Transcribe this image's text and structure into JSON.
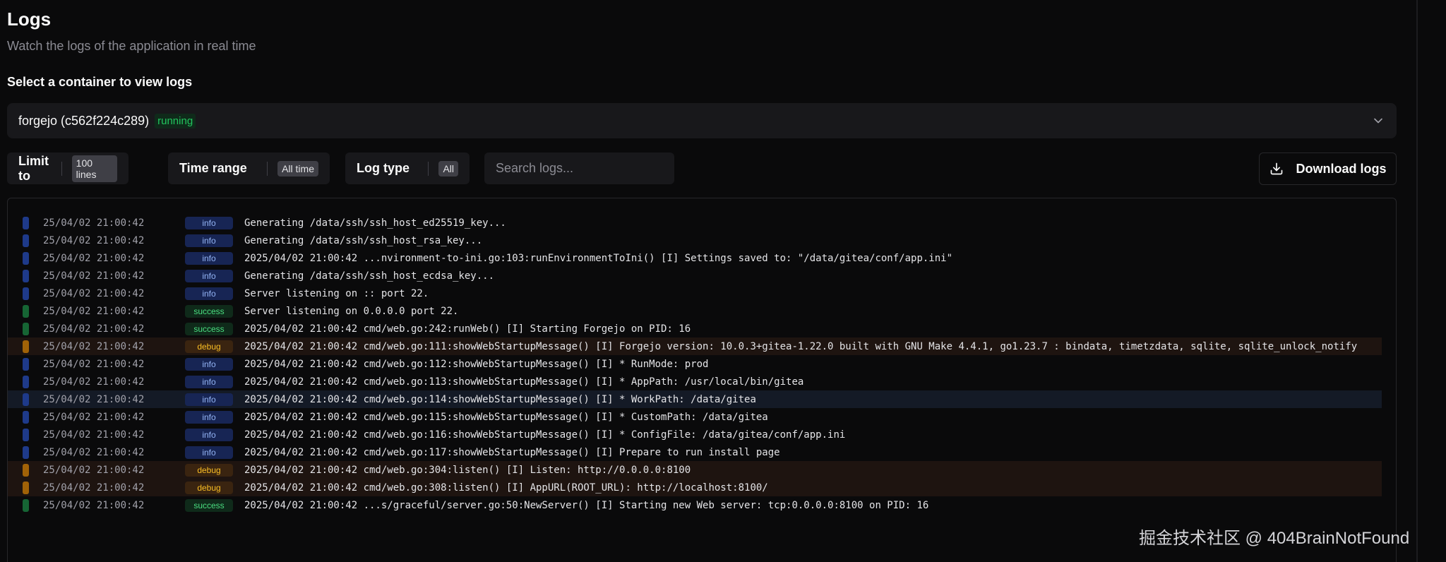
{
  "header": {
    "title": "Logs",
    "subtitle": "Watch the logs of the application in real time",
    "select_label": "Select a container to view logs"
  },
  "container_select": {
    "name": "forgejo (c562f224c289)",
    "status": "running"
  },
  "filters": {
    "limit": {
      "label": "Limit to",
      "value": "100 lines"
    },
    "time_range": {
      "label": "Time range",
      "value": "All time"
    },
    "log_type": {
      "label": "Log type",
      "value": "All"
    },
    "search_placeholder": "Search logs...",
    "download_label": "Download logs"
  },
  "colors": {
    "info": "#1e3a8a",
    "success": "#166534",
    "debug": "#a16207",
    "running": "#22c55e"
  },
  "logs": [
    {
      "time": "25/04/02 21:00:42",
      "level": "info",
      "message": "Generating /data/ssh/ssh_host_ed25519_key..."
    },
    {
      "time": "25/04/02 21:00:42",
      "level": "info",
      "message": "Generating /data/ssh/ssh_host_rsa_key..."
    },
    {
      "time": "25/04/02 21:00:42",
      "level": "info",
      "message": "2025/04/02 21:00:42 ...nvironment-to-ini.go:103:runEnvironmentToIni() [I] Settings saved to: \"/data/gitea/conf/app.ini\""
    },
    {
      "time": "25/04/02 21:00:42",
      "level": "info",
      "message": "Generating /data/ssh/ssh_host_ecdsa_key..."
    },
    {
      "time": "25/04/02 21:00:42",
      "level": "info",
      "message": "Server listening on :: port 22."
    },
    {
      "time": "25/04/02 21:00:42",
      "level": "success",
      "message": "Server listening on 0.0.0.0 port 22."
    },
    {
      "time": "25/04/02 21:00:42",
      "level": "success",
      "message": "2025/04/02 21:00:42 cmd/web.go:242:runWeb() [I] Starting Forgejo on PID: 16"
    },
    {
      "time": "25/04/02 21:00:42",
      "level": "debug",
      "message": "2025/04/02 21:00:42 cmd/web.go:111:showWebStartupMessage() [I] Forgejo version: 10.0.3+gitea-1.22.0 built with GNU Make 4.4.1, go1.23.7 : bindata, timetzdata, sqlite, sqlite_unlock_notify"
    },
    {
      "time": "25/04/02 21:00:42",
      "level": "info",
      "message": "2025/04/02 21:00:42 cmd/web.go:112:showWebStartupMessage() [I] * RunMode: prod"
    },
    {
      "time": "25/04/02 21:00:42",
      "level": "info",
      "message": "2025/04/02 21:00:42 cmd/web.go:113:showWebStartupMessage() [I] * AppPath: /usr/local/bin/gitea"
    },
    {
      "time": "25/04/02 21:00:42",
      "level": "info",
      "message": "2025/04/02 21:00:42 cmd/web.go:114:showWebStartupMessage() [I] * WorkPath: /data/gitea",
      "hover": true
    },
    {
      "time": "25/04/02 21:00:42",
      "level": "info",
      "message": "2025/04/02 21:00:42 cmd/web.go:115:showWebStartupMessage() [I] * CustomPath: /data/gitea"
    },
    {
      "time": "25/04/02 21:00:42",
      "level": "info",
      "message": "2025/04/02 21:00:42 cmd/web.go:116:showWebStartupMessage() [I] * ConfigFile: /data/gitea/conf/app.ini"
    },
    {
      "time": "25/04/02 21:00:42",
      "level": "info",
      "message": "2025/04/02 21:00:42 cmd/web.go:117:showWebStartupMessage() [I] Prepare to run install page"
    },
    {
      "time": "25/04/02 21:00:42",
      "level": "debug",
      "message": "2025/04/02 21:00:42 cmd/web.go:304:listen() [I] Listen: http://0.0.0.0:8100"
    },
    {
      "time": "25/04/02 21:00:42",
      "level": "debug",
      "message": "2025/04/02 21:00:42 cmd/web.go:308:listen() [I] AppURL(ROOT_URL): http://localhost:8100/"
    },
    {
      "time": "25/04/02 21:00:42",
      "level": "success",
      "message": "2025/04/02 21:00:42 ...s/graceful/server.go:50:NewServer() [I] Starting new Web server: tcp:0.0.0.0:8100 on PID: 16"
    }
  ],
  "watermark": "掘金技术社区 @ 404BrainNotFound"
}
